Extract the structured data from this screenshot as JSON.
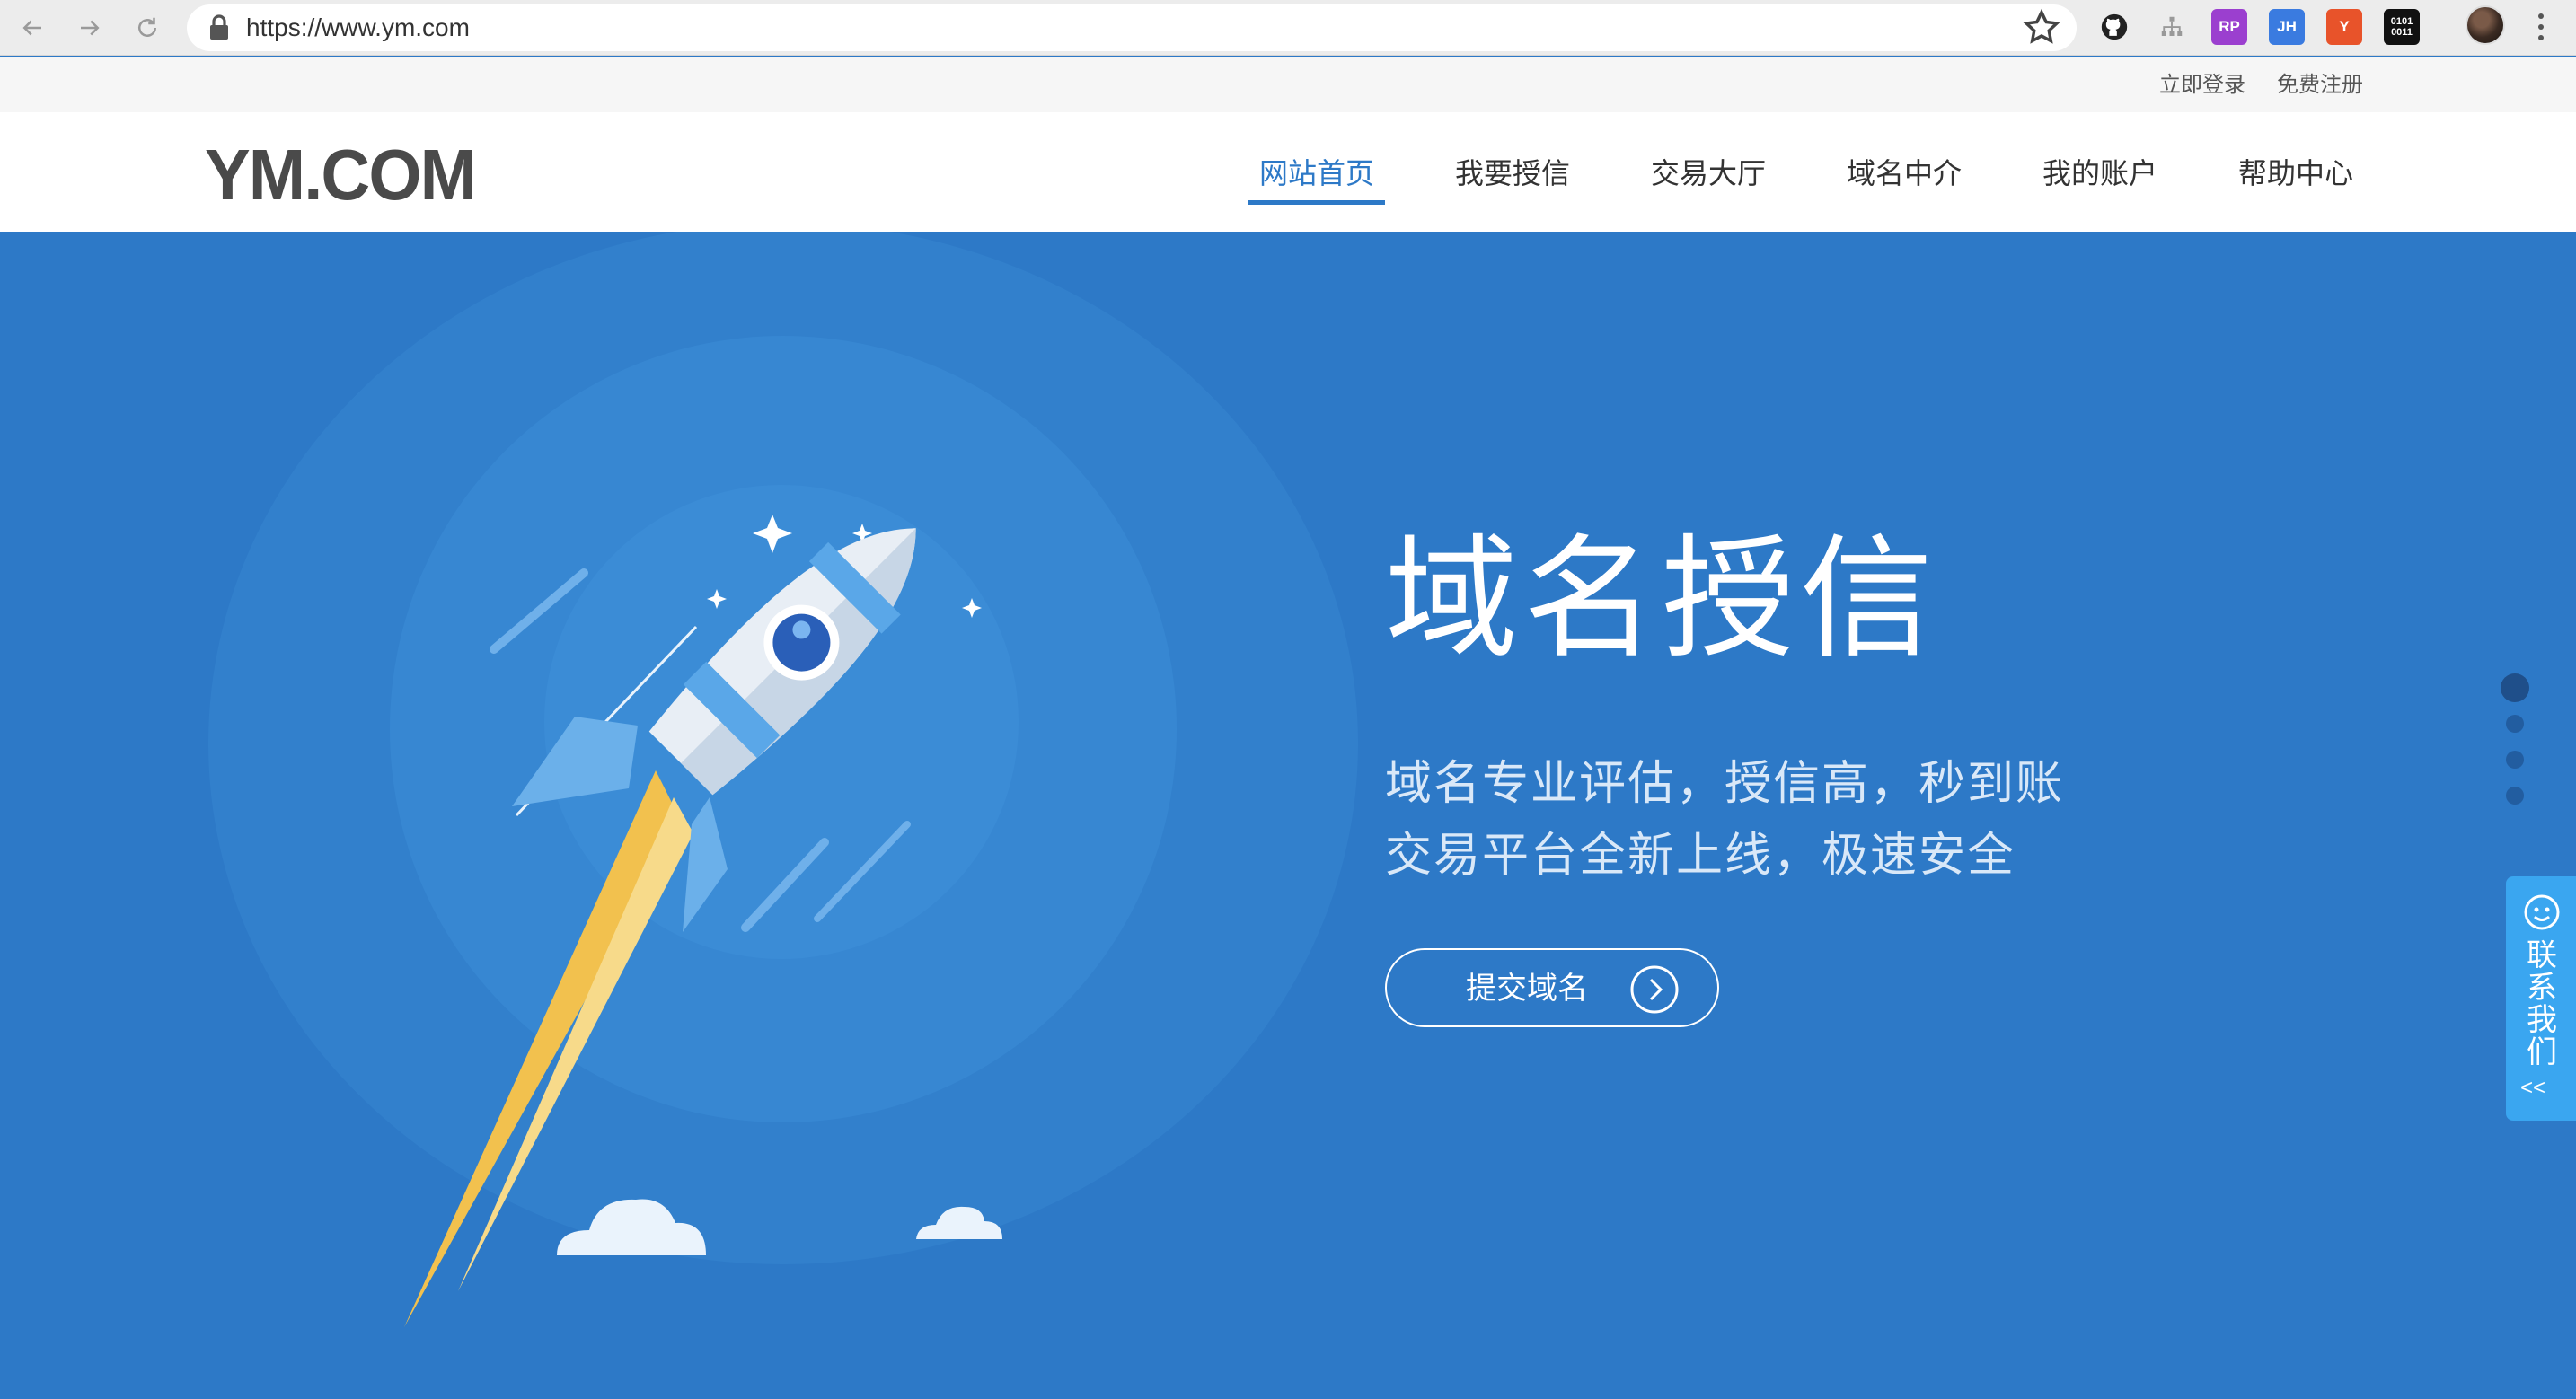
{
  "browser": {
    "url": "https://www.ym.com",
    "extensions": [
      {
        "name": "github-icon",
        "label": ""
      },
      {
        "name": "sitemap-icon",
        "label": ""
      },
      {
        "name": "rp-extension-icon",
        "label": "RP"
      },
      {
        "name": "jh-extension-icon",
        "label": "JH"
      },
      {
        "name": "yslow-extension-icon",
        "label": "Y"
      },
      {
        "name": "binary-extension-icon",
        "label": "0101 0011"
      }
    ]
  },
  "topbar": {
    "login": "立即登录",
    "register": "免费注册"
  },
  "header": {
    "logo": "YM.COM",
    "nav": [
      {
        "label": "网站首页",
        "active": true
      },
      {
        "label": "我要授信",
        "active": false
      },
      {
        "label": "交易大厅",
        "active": false
      },
      {
        "label": "域名中介",
        "active": false
      },
      {
        "label": "我的账户",
        "active": false
      },
      {
        "label": "帮助中心",
        "active": false
      }
    ]
  },
  "hero": {
    "title": "域名授信",
    "subtitle_line1": "域名专业评估，授信高，秒到账",
    "subtitle_line2": "交易平台全新上线，极速安全",
    "cta_label": "提交域名",
    "slides_total": 4,
    "slides_active": 1
  },
  "contact": {
    "label": "联系我们",
    "arrow": "<<"
  },
  "colors": {
    "primary": "#2d79c7",
    "contact_tab": "#3aa6f0",
    "logo_gray": "#4a4a4a",
    "rocket_flame": "#f2c14e"
  }
}
